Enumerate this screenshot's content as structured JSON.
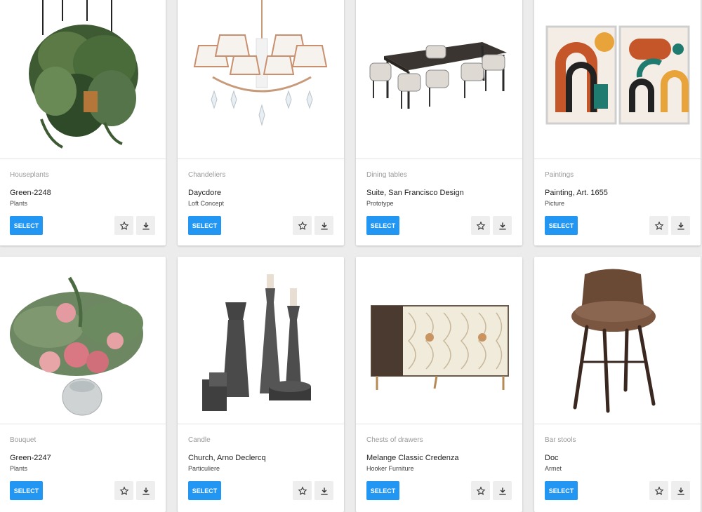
{
  "colors": {
    "accent": "#2196f3",
    "background": "#ececec"
  },
  "products": [
    {
      "category": "Houseplants",
      "name": "Green-2248",
      "brand": "Plants",
      "select_label": "SELECT",
      "image": "hanging-plant"
    },
    {
      "category": "Chandeliers",
      "name": "Daycdore",
      "brand": "Loft Concept",
      "select_label": "SELECT",
      "image": "chandelier"
    },
    {
      "category": "Dining tables",
      "name": "Suite, San Francisco Design",
      "brand": "Prototype",
      "select_label": "SELECT",
      "image": "dining-set"
    },
    {
      "category": "Paintings",
      "name": "Painting, Art. 1655",
      "brand": "Picture",
      "select_label": "SELECT",
      "image": "abstract-paintings"
    },
    {
      "category": "Bouquet",
      "name": "Green-2247",
      "brand": "Plants",
      "select_label": "SELECT",
      "image": "flower-bouquet"
    },
    {
      "category": "Candle",
      "name": "Church, Arno Declercq",
      "brand": "Particuliere",
      "select_label": "SELECT",
      "image": "candle-holders"
    },
    {
      "category": "Chests of drawers",
      "name": "Melange Classic Credenza",
      "brand": "Hooker Furniture",
      "select_label": "SELECT",
      "image": "credenza"
    },
    {
      "category": "Bar stools",
      "name": "Doc",
      "brand": "Armet",
      "select_label": "SELECT",
      "image": "bar-stool"
    }
  ],
  "icons": {
    "favorite": "star-outline-icon",
    "download": "download-icon"
  }
}
